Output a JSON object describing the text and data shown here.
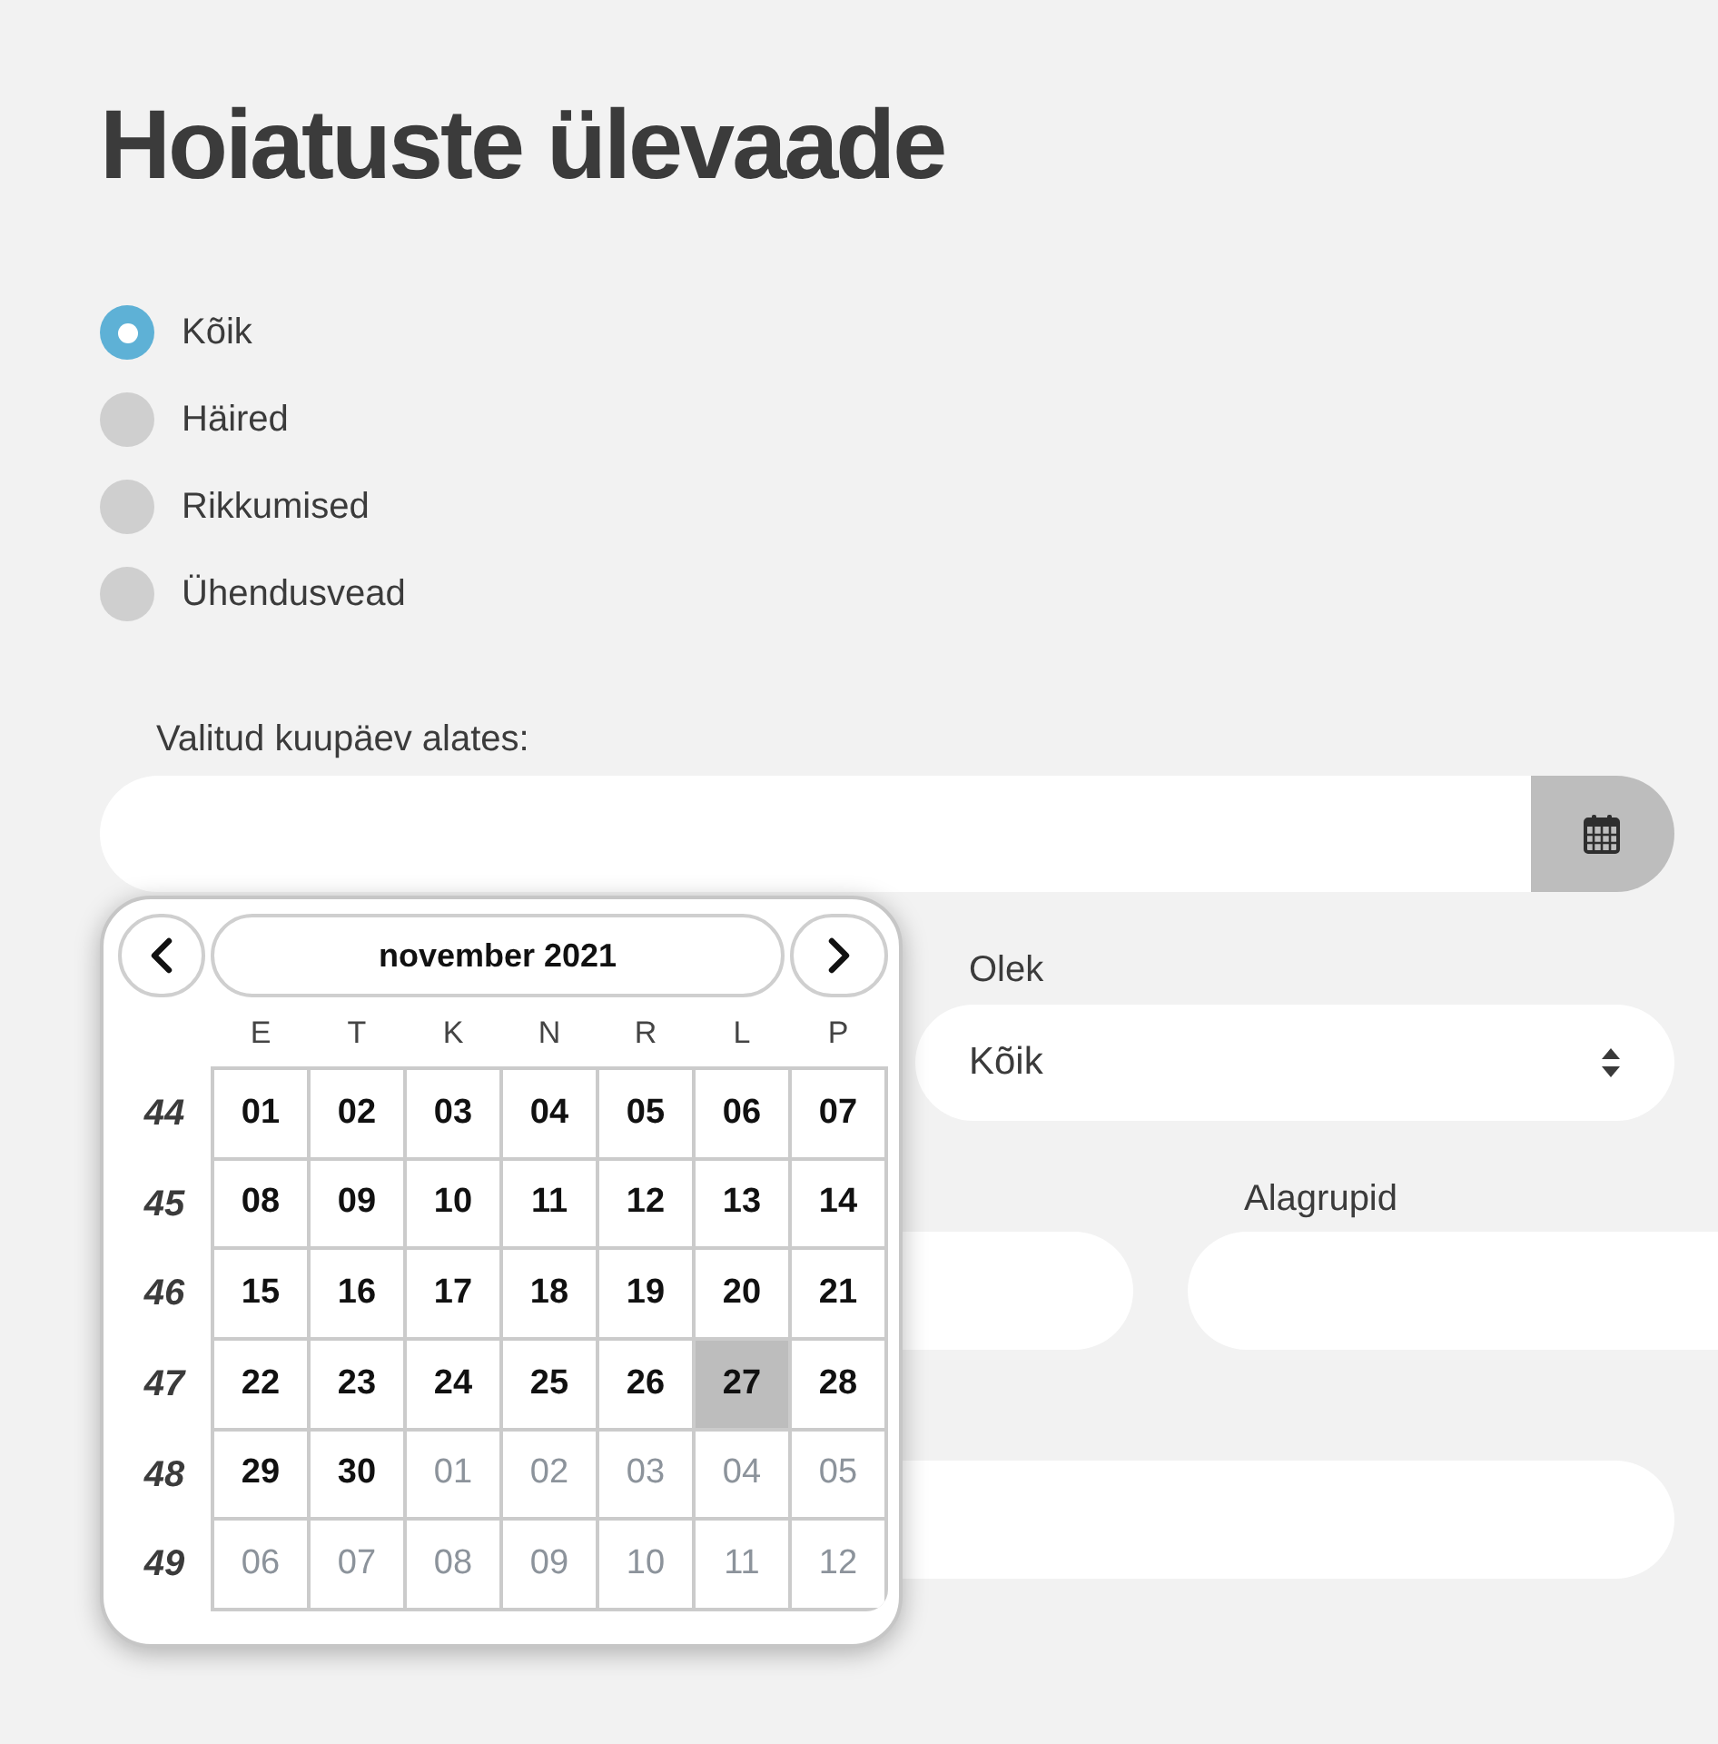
{
  "page_title": "Hoiatuste ülevaade",
  "alert_filter": [
    {
      "label": "Kõik",
      "selected": true
    },
    {
      "label": "Häired",
      "selected": false
    },
    {
      "label": "Rikkumised",
      "selected": false
    },
    {
      "label": "Ühendusvead",
      "selected": false
    }
  ],
  "date_from": {
    "label": "Valitud kuupäev alates:"
  },
  "datepicker": {
    "month": "november 2021",
    "weekdays": [
      "E",
      "T",
      "K",
      "N",
      "R",
      "L",
      "P"
    ],
    "weeks": [
      {
        "number": "44",
        "days": [
          {
            "day": "01",
            "other_month": false,
            "selected": false
          },
          {
            "day": "02",
            "other_month": false,
            "selected": false
          },
          {
            "day": "03",
            "other_month": false,
            "selected": false
          },
          {
            "day": "04",
            "other_month": false,
            "selected": false
          },
          {
            "day": "05",
            "other_month": false,
            "selected": false
          },
          {
            "day": "06",
            "other_month": false,
            "selected": false
          },
          {
            "day": "07",
            "other_month": false,
            "selected": false
          }
        ]
      },
      {
        "number": "45",
        "days": [
          {
            "day": "08",
            "other_month": false,
            "selected": false
          },
          {
            "day": "09",
            "other_month": false,
            "selected": false
          },
          {
            "day": "10",
            "other_month": false,
            "selected": false
          },
          {
            "day": "11",
            "other_month": false,
            "selected": false
          },
          {
            "day": "12",
            "other_month": false,
            "selected": false
          },
          {
            "day": "13",
            "other_month": false,
            "selected": false
          },
          {
            "day": "14",
            "other_month": false,
            "selected": false
          }
        ]
      },
      {
        "number": "46",
        "days": [
          {
            "day": "15",
            "other_month": false,
            "selected": false
          },
          {
            "day": "16",
            "other_month": false,
            "selected": false
          },
          {
            "day": "17",
            "other_month": false,
            "selected": false
          },
          {
            "day": "18",
            "other_month": false,
            "selected": false
          },
          {
            "day": "19",
            "other_month": false,
            "selected": false
          },
          {
            "day": "20",
            "other_month": false,
            "selected": false
          },
          {
            "day": "21",
            "other_month": false,
            "selected": false
          }
        ]
      },
      {
        "number": "47",
        "days": [
          {
            "day": "22",
            "other_month": false,
            "selected": false
          },
          {
            "day": "23",
            "other_month": false,
            "selected": false
          },
          {
            "day": "24",
            "other_month": false,
            "selected": false
          },
          {
            "day": "25",
            "other_month": false,
            "selected": false
          },
          {
            "day": "26",
            "other_month": false,
            "selected": false
          },
          {
            "day": "27",
            "other_month": false,
            "selected": true
          },
          {
            "day": "28",
            "other_month": false,
            "selected": false
          }
        ]
      },
      {
        "number": "48",
        "days": [
          {
            "day": "29",
            "other_month": false,
            "selected": false
          },
          {
            "day": "30",
            "other_month": false,
            "selected": false
          },
          {
            "day": "01",
            "other_month": true,
            "selected": false
          },
          {
            "day": "02",
            "other_month": true,
            "selected": false
          },
          {
            "day": "03",
            "other_month": true,
            "selected": false
          },
          {
            "day": "04",
            "other_month": true,
            "selected": false
          },
          {
            "day": "05",
            "other_month": true,
            "selected": false
          }
        ]
      },
      {
        "number": "49",
        "days": [
          {
            "day": "06",
            "other_month": true,
            "selected": false
          },
          {
            "day": "07",
            "other_month": true,
            "selected": false
          },
          {
            "day": "08",
            "other_month": true,
            "selected": false
          },
          {
            "day": "09",
            "other_month": true,
            "selected": false
          },
          {
            "day": "10",
            "other_month": true,
            "selected": false
          },
          {
            "day": "11",
            "other_month": true,
            "selected": false
          },
          {
            "day": "12",
            "other_month": true,
            "selected": false
          }
        ]
      }
    ]
  },
  "status": {
    "label": "Olek",
    "value": "Kõik"
  },
  "subgroups": {
    "label": "Alagrupid"
  }
}
